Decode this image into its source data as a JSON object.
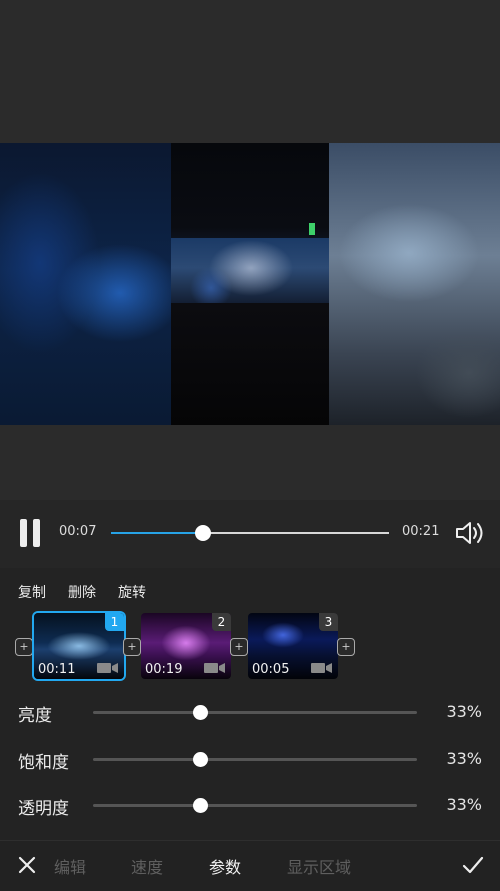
{
  "player": {
    "current_time": "00:07",
    "total_time": "00:21",
    "progress": 0.33
  },
  "actions": [
    "复制",
    "删除",
    "旋转"
  ],
  "clips": [
    {
      "number": "1",
      "duration": "00:11",
      "selected": true
    },
    {
      "number": "2",
      "duration": "00:19",
      "selected": false
    },
    {
      "number": "3",
      "duration": "00:05",
      "selected": false
    }
  ],
  "params": [
    {
      "label": "亮度",
      "value": "33%",
      "level": 0.33
    },
    {
      "label": "饱和度",
      "value": "33%",
      "level": 0.33
    },
    {
      "label": "透明度",
      "value": "33%",
      "level": 0.33
    }
  ],
  "bottom_tabs": [
    "编辑",
    "速度",
    "参数",
    "显示区域"
  ],
  "active_tab": "参数",
  "icons": {
    "add_clip": "+",
    "close": "close-icon",
    "confirm": "checkmark-icon",
    "video": "video-camera-icon",
    "volume": "speaker-icon",
    "pause": "pause-icon"
  },
  "colors": {
    "accent": "#22a8f0",
    "progress": "#27a3e6",
    "background": "#262626"
  }
}
